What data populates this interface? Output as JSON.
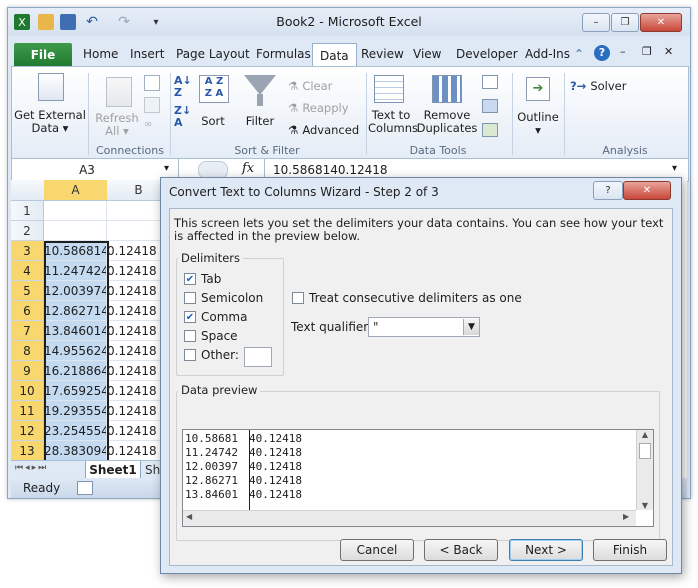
{
  "window": {
    "title": "Book2 - Microsoft Excel",
    "controls": [
      "–",
      "❐",
      "✕"
    ]
  },
  "ribbon_tabs": [
    "File",
    "Home",
    "Insert",
    "Page Layout",
    "Formulas",
    "Data",
    "Review",
    "View",
    "Developer",
    "Add-Ins"
  ],
  "ribbon": {
    "get_external_line1": "Get External",
    "get_external_line2": "Data",
    "refresh_line1": "Refresh",
    "refresh_line2": "All",
    "connections_label": "Connections",
    "sort_label": "Sort",
    "filter_label": "Filter",
    "clear_label": "Clear",
    "reapply_label": "Reapply",
    "advanced_label": "Advanced",
    "sort_filter_label": "Sort & Filter",
    "text_to_columns_line1": "Text to",
    "text_to_columns_line2": "Columns",
    "remove_duplicates_line1": "Remove",
    "remove_duplicates_line2": "Duplicates",
    "data_tools_label": "Data Tools",
    "outline_label": "Outline",
    "solver_label": "Solver",
    "analysis_label": "Analysis"
  },
  "formula_bar": {
    "name_box": "A3",
    "fx": "fx",
    "value": "10.5868140.12418"
  },
  "grid": {
    "columns": [
      "A",
      "B"
    ],
    "rows": [
      {
        "num": "1",
        "a": "",
        "b": ""
      },
      {
        "num": "2",
        "a": "",
        "b": ""
      },
      {
        "num": "3",
        "a": "10.586814",
        "b": "0.12418"
      },
      {
        "num": "4",
        "a": "11.247424",
        "b": "0.12418"
      },
      {
        "num": "5",
        "a": "12.003974",
        "b": "0.12418"
      },
      {
        "num": "6",
        "a": "12.862714",
        "b": "0.12418"
      },
      {
        "num": "7",
        "a": "13.846014",
        "b": "0.12418"
      },
      {
        "num": "8",
        "a": "14.955624",
        "b": "0.12418"
      },
      {
        "num": "9",
        "a": "16.218864",
        "b": "0.12418"
      },
      {
        "num": "10",
        "a": "17.659254",
        "b": "0.12418"
      },
      {
        "num": "11",
        "a": "19.293554",
        "b": "0.12418"
      },
      {
        "num": "12",
        "a": "23.254554",
        "b": "0.12418"
      },
      {
        "num": "13",
        "a": "28.383094",
        "b": "0.12418"
      }
    ],
    "sheet_tab": "Sheet1",
    "sheet_tab2": "Sh"
  },
  "status": {
    "ready": "Ready"
  },
  "dialog": {
    "title": "Convert Text to Columns Wizard - Step 2 of 3",
    "help": "?",
    "close": "✕",
    "description": "This screen lets you set the delimiters your data contains.  You can see how your text is affected in the preview below.",
    "delimiters_legend": "Delimiters",
    "delimiters": [
      {
        "label": "Tab",
        "checked": true
      },
      {
        "label": "Semicolon",
        "checked": false
      },
      {
        "label": "Comma",
        "checked": true
      },
      {
        "label": "Space",
        "checked": false
      },
      {
        "label": "Other:",
        "checked": false
      }
    ],
    "treat_consecutive": "Treat consecutive delimiters as one",
    "text_qualifier_label": "Text qualifier:",
    "text_qualifier_value": "\"",
    "data_preview_legend": "Data preview",
    "preview_rows": [
      [
        "10.58681",
        "40.12418"
      ],
      [
        "11.24742",
        "40.12418"
      ],
      [
        "12.00397",
        "40.12418"
      ],
      [
        "12.86271",
        "40.12418"
      ],
      [
        "13.84601",
        "40.12418"
      ]
    ],
    "buttons": {
      "cancel": "Cancel",
      "back": "< Back",
      "next": "Next >",
      "finish": "Finish"
    }
  },
  "colors": {
    "accent": "#2a6fbf",
    "file_tab": "#1f7a2f",
    "selected_header": "#f8d76e",
    "selected_cells": "#c4daf1"
  }
}
